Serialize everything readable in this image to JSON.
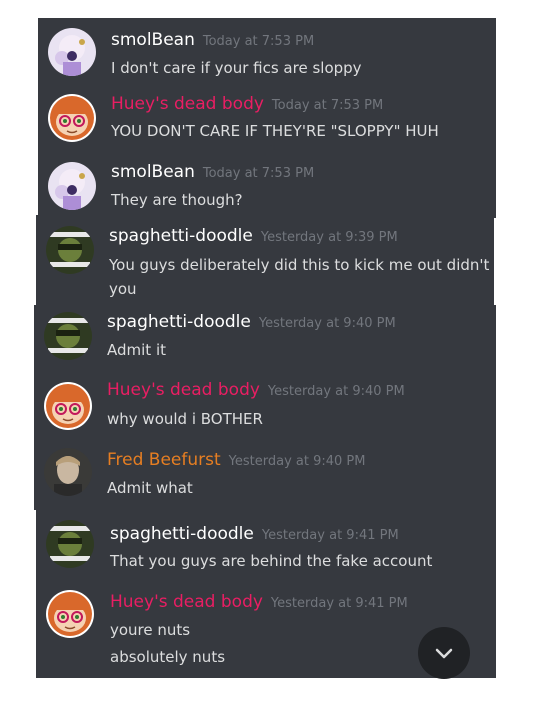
{
  "colors": {
    "smolbean": "#ffffff",
    "huey": "#e91e63",
    "spaghetti": "#ffffff",
    "fred": "#e67e22"
  },
  "messages": [
    {
      "author": "smolBean",
      "time": "Today at 7:53 PM",
      "lines": [
        "I don't care if your fics are sloppy"
      ],
      "avatar": "smolbean-avatar"
    },
    {
      "author": "Huey's dead body",
      "time": "Today at 7:53 PM",
      "lines": [
        "YOU DON'T CARE IF THEY'RE \"SLOPPY\" HUH"
      ],
      "avatar": "huey-avatar"
    },
    {
      "author": "smolBean",
      "time": "Today at 7:53 PM",
      "lines": [
        "They are though?"
      ],
      "avatar": "smolbean-avatar"
    },
    {
      "author": "spaghetti-doodle",
      "time": "Yesterday at 9:39 PM",
      "lines": [
        "You guys deliberately did this to kick me out didn't",
        "you"
      ],
      "avatar": "spaghetti-avatar"
    },
    {
      "author": "spaghetti-doodle",
      "time": "Yesterday at 9:40 PM",
      "lines": [
        "Admit it"
      ],
      "avatar": "spaghetti-avatar"
    },
    {
      "author": "Huey's dead body",
      "time": "Yesterday at 9:40 PM",
      "lines": [
        "why would i BOTHER"
      ],
      "avatar": "huey-avatar"
    },
    {
      "author": "Fred Beefurst",
      "time": "Yesterday at 9:40 PM",
      "lines": [
        "Admit what"
      ],
      "avatar": "fred-avatar"
    },
    {
      "author": "spaghetti-doodle",
      "time": "Yesterday at 9:41 PM",
      "lines": [
        "That you guys are behind the fake account"
      ],
      "avatar": "spaghetti-avatar"
    },
    {
      "author": "Huey's dead body",
      "time": "Yesterday at 9:41 PM",
      "lines": [
        "youre nuts",
        "absolutely nuts"
      ],
      "avatar": "huey-avatar"
    }
  ],
  "scroll_button": {
    "icon": "chevron-down-icon"
  }
}
